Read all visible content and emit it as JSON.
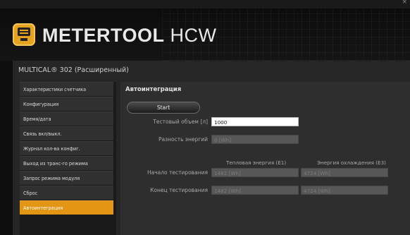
{
  "window": {
    "close_glyph": "×"
  },
  "header": {
    "brand_bold": "METERTOOL",
    "brand_light": " HCW",
    "logo_icon": "meter-device-icon"
  },
  "device": {
    "title": "MULTICAL® 302  (Расширенный)"
  },
  "sidebar": {
    "items": [
      {
        "label": "Характеристики счетчика",
        "active": false
      },
      {
        "label": "Конфигурация",
        "active": false
      },
      {
        "label": "Время/дата",
        "active": false
      },
      {
        "label": "Связь вкл/выкл.",
        "active": false
      },
      {
        "label": "Журнал кол-ва конфиг.",
        "active": false
      },
      {
        "label": "Выход из транс-го режима",
        "active": false
      },
      {
        "label": "Запрос режима модуля",
        "active": false
      },
      {
        "label": "Сброс",
        "active": false
      },
      {
        "label": "Автоинтеграция",
        "active": true
      }
    ]
  },
  "main": {
    "section_title": "Автоинтеграция",
    "start_label": "Start",
    "test_volume": {
      "label": "Тестовый объем [л]",
      "value": "1000"
    },
    "energy_difference": {
      "label": "Разность энергий",
      "value": "0 [Wh]"
    },
    "columns": {
      "heat": "Тепловая энергия (E1)",
      "cool": "Энергия охлаждения (E3)"
    },
    "rows": [
      {
        "label": "Начало тестирования",
        "heat": "1482 [Wh]",
        "cool": "4724 [Wh]"
      },
      {
        "label": "Конец тестирования",
        "heat": "1482 [Wh]",
        "cool": "4724 [Wh]"
      }
    ]
  }
}
